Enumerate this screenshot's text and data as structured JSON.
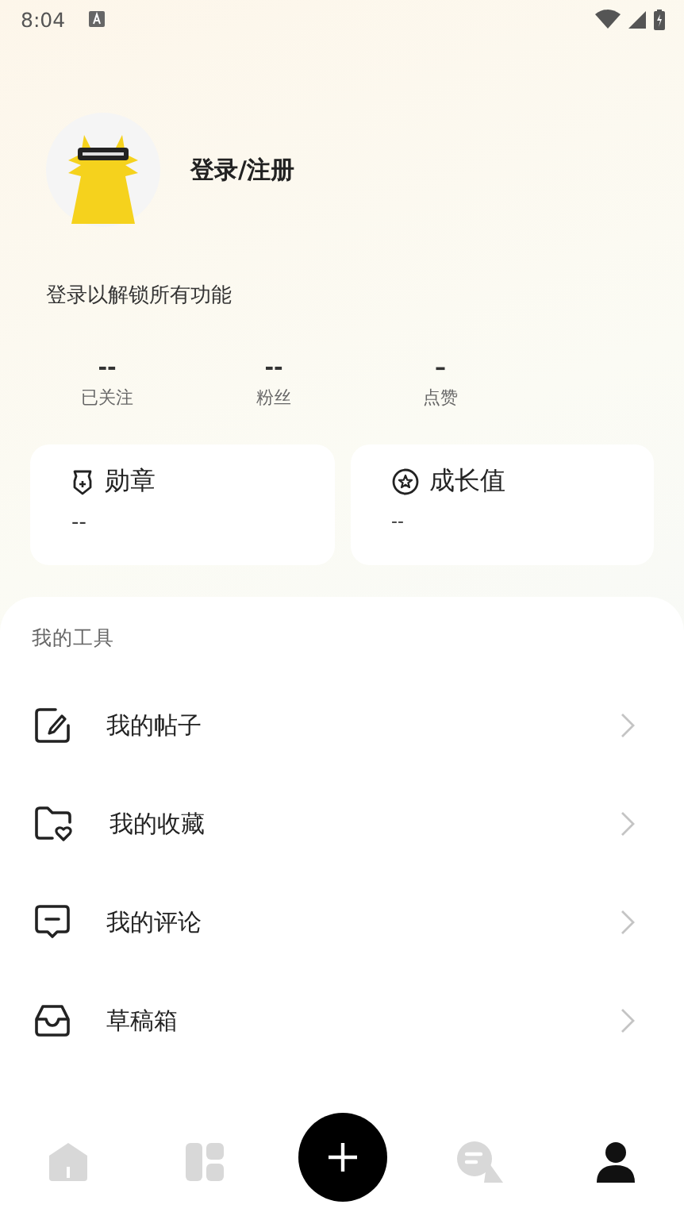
{
  "status_bar": {
    "time": "8:04"
  },
  "profile": {
    "login_label": "登录/注册",
    "subtitle": "登录以解锁所有功能"
  },
  "stats": [
    {
      "value": "--",
      "label": "已关注"
    },
    {
      "value": "--",
      "label": "粉丝"
    },
    {
      "value": "–",
      "label": "点赞"
    }
  ],
  "cards": [
    {
      "kind": "badge",
      "title": "勋章",
      "value": "--"
    },
    {
      "kind": "growth",
      "title": "成长值",
      "value": "--"
    }
  ],
  "tools": {
    "title": "我的工具",
    "items": [
      {
        "kind": "posts",
        "label": "我的帖子"
      },
      {
        "kind": "favorites",
        "label": "我的收藏"
      },
      {
        "kind": "comments",
        "label": "我的评论"
      },
      {
        "kind": "drafts",
        "label": "草稿箱"
      }
    ]
  },
  "nav": [
    {
      "kind": "home",
      "selected": false
    },
    {
      "kind": "apps",
      "selected": false
    },
    {
      "kind": "add",
      "selected": false
    },
    {
      "kind": "messages",
      "selected": false
    },
    {
      "kind": "profile",
      "selected": true
    }
  ]
}
